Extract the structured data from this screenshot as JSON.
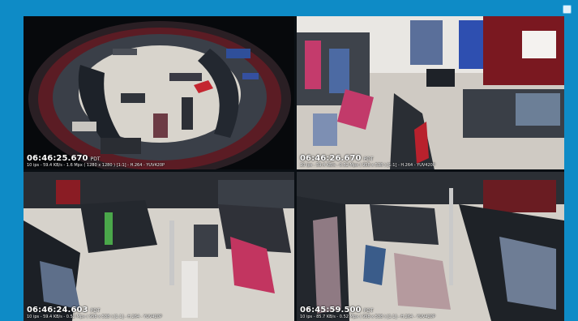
{
  "window": {
    "corner_button_icon": "square-icon"
  },
  "tiles": [
    {
      "view": "fisheye",
      "timestamp": "06:46:25.670",
      "tz": "PDT",
      "meta": "10 ips  -  59.4 KB/s  -  1.6 Mpx  ( 1280 x 1280 ) [1:1]  -  H.264  -  YUV420P"
    },
    {
      "view": "store-overview",
      "timestamp": "06:46:26.670",
      "tz": "PDT",
      "meta": "10 ips  -  59.4 KB/s  -  0.52 Mpx  ( 958 x 538 ) [1:1]  -  H.264  -  YUV420P"
    },
    {
      "view": "store-clothing-racks",
      "timestamp": "06:46:24.603",
      "tz": "PDT",
      "meta": "10 ips  -  59.4 KB/s  -  0.52 Mpx  ( 958 x 538 ) [1:1]  -  H.264  -  YUV420P"
    },
    {
      "view": "store-aisle",
      "timestamp": "06:45:59.500",
      "tz": "PDT",
      "meta": "10 ips  -  85.7 KB/s  -  0.52 Mpx  ( 958 x 538 ) [1:1]  -  H.264  -  YUV420P"
    }
  ],
  "colors": {
    "frame": "#0e8bc6",
    "floor": "#d9d6d0",
    "wall_red": "#8e1b22",
    "shelf": "#2b2f36"
  }
}
